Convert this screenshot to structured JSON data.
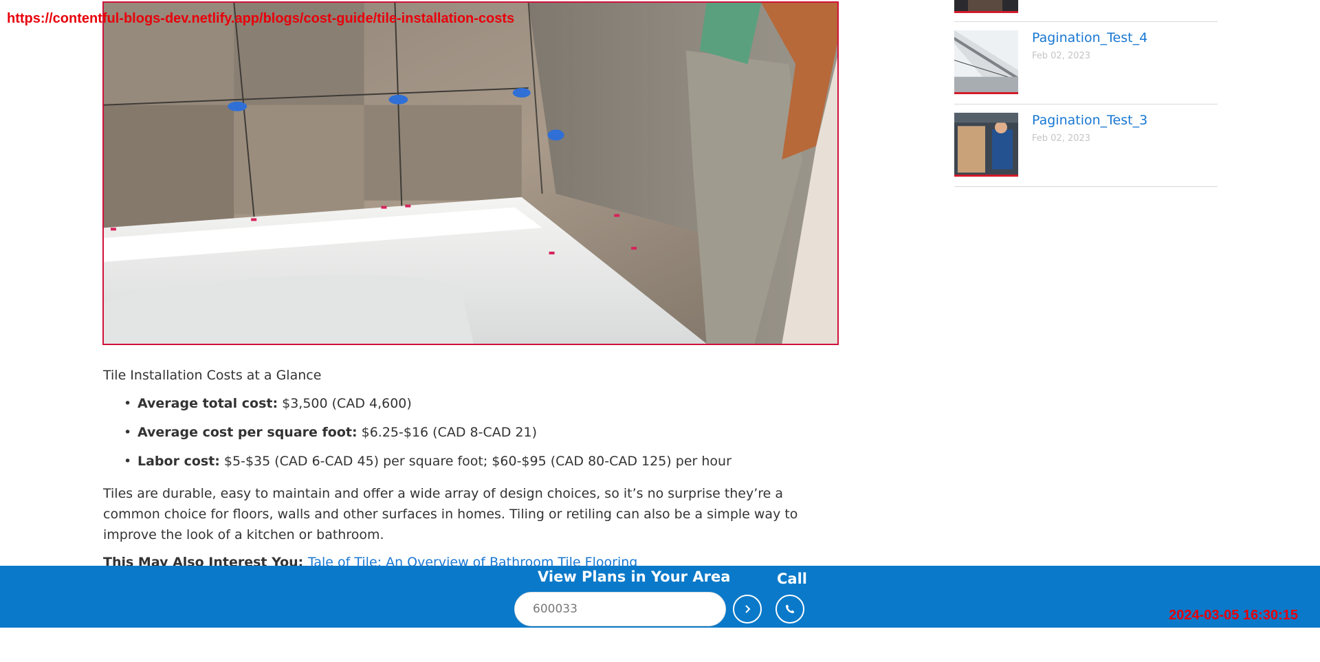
{
  "browser": {
    "url": "https://contentful-blogs-dev.netlify.app/blogs/cost-guide/tile-installation-costs",
    "timestamp": "2024-03-05 16:30:15"
  },
  "hero": {
    "alt": "Tiled bathroom wall above a white bathtub"
  },
  "article": {
    "heading": "Tile Installation Costs at a Glance",
    "bullets": [
      {
        "label": "Average total cost:",
        "value": " $3,500 (CAD 4,600)"
      },
      {
        "label": "Average cost per square foot:",
        "value": " $6.25-$16 (CAD 8-CAD 21)"
      },
      {
        "label": "Labor cost:",
        "value": " $5-$35 (CAD 6-CAD 45) per square foot; $60-$95 (CAD 80-CAD 125) per hour"
      }
    ],
    "paragraph": "Tiles are durable, easy to maintain and offer a wide array of design choices, so it’s no surprise they’re a common choice for floors, walls and other surfaces in homes. Tiling or retiling can also be a simple way to improve the look of a kitchen or bathroom.",
    "related_prefix": "This May Also Interest You: ",
    "related_link": "Tale of Tile: An Overview of Bathroom Tile Flooring"
  },
  "sidebar": {
    "items": [
      {
        "title": "Pagination_Test_4",
        "date": "Feb 02, 2023",
        "thumb_icon": "house-roof-thumbnail"
      },
      {
        "title": "Pagination_Test_3",
        "date": "Feb 02, 2023",
        "thumb_icon": "technician-thumbnail"
      }
    ]
  },
  "footer": {
    "title": "View Plans in Your Area",
    "zip_value": "600033",
    "call_label": "Call",
    "go_icon": "chevron-right-icon",
    "call_icon": "phone-icon",
    "accent_color": "#0a79c9"
  }
}
